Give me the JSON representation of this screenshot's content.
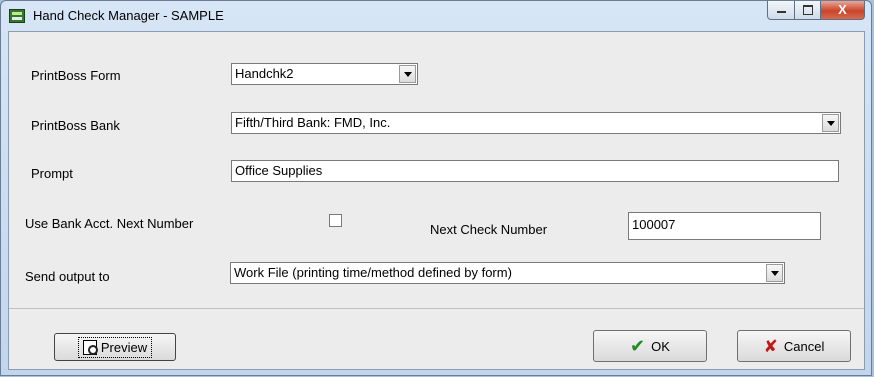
{
  "window": {
    "title": "Hand Check Manager - SAMPLE",
    "icon": "printboss-app-icon",
    "close_glyph": "X"
  },
  "form": {
    "printboss_form": {
      "label": "PrintBoss Form",
      "value": "Handchk2"
    },
    "printboss_bank": {
      "label": "PrintBoss Bank",
      "value": "Fifth/Third Bank:  FMD, Inc."
    },
    "prompt": {
      "label": "Prompt",
      "value": "Office Supplies"
    },
    "use_bank_acct": {
      "label": "Use Bank Acct. Next Number",
      "checked": false
    },
    "next_check": {
      "label": "Next Check Number",
      "value": "100007"
    },
    "send_output": {
      "label": "Send output to",
      "value": "Work File (printing time/method defined by form)"
    }
  },
  "buttons": {
    "preview": "Preview",
    "ok": "OK",
    "cancel": "Cancel"
  },
  "colors": {
    "ok_check": "#1f8a1f",
    "cancel_x": "#c01818",
    "close_button": "#c9452a"
  }
}
